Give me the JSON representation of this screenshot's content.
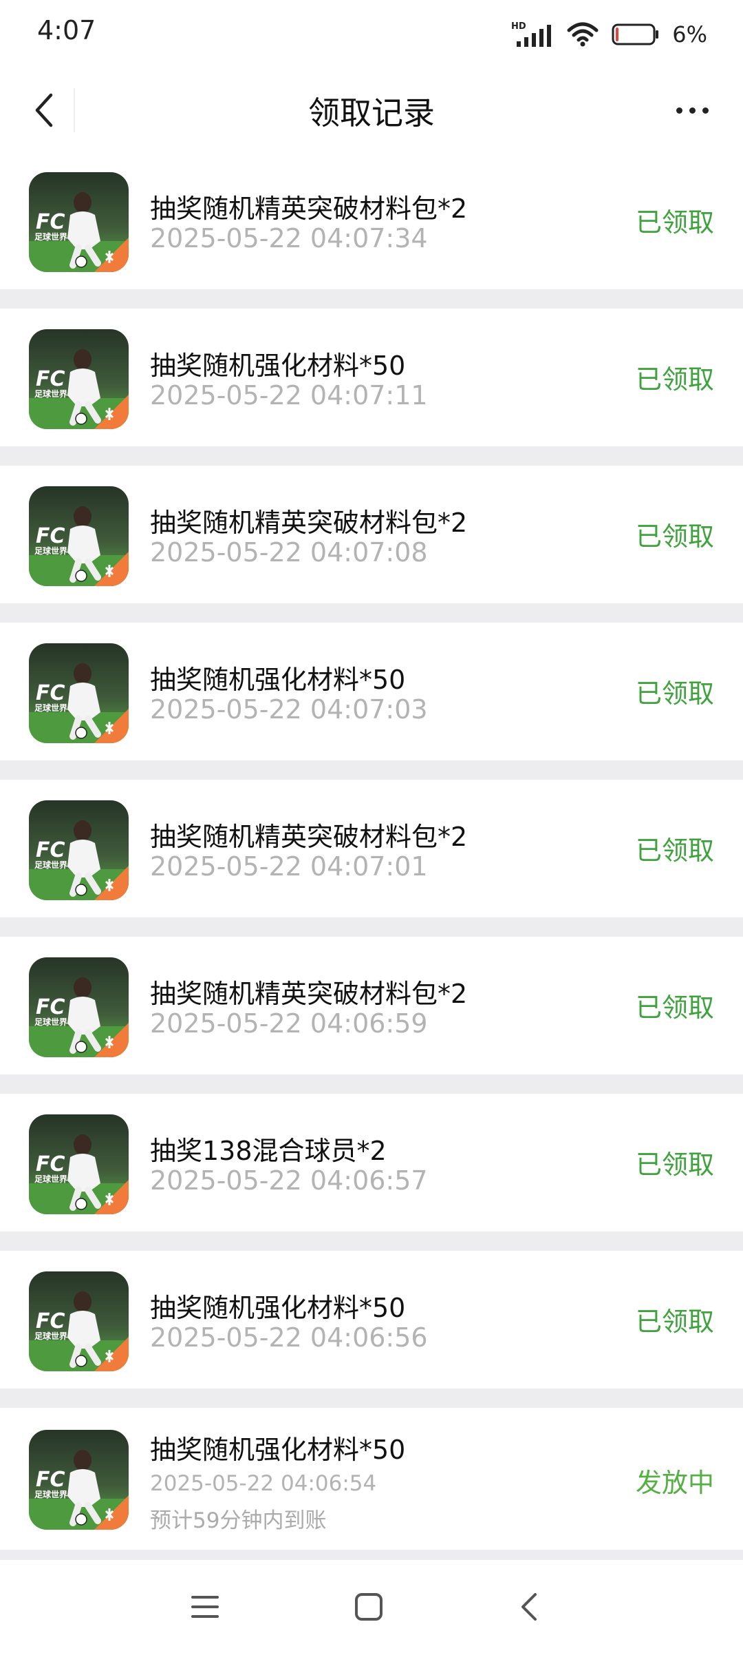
{
  "status_bar": {
    "time": "4:07",
    "network_label": "HD",
    "battery_percent": "6%",
    "battery_level": 0.06
  },
  "header": {
    "title": "领取记录"
  },
  "records": [
    {
      "title": "抽奖随机精英突破材料包*2",
      "time": "2025-05-22 04:07:34",
      "status": "已领取"
    },
    {
      "title": "抽奖随机强化材料*50",
      "time": "2025-05-22 04:07:11",
      "status": "已领取"
    },
    {
      "title": "抽奖随机精英突破材料包*2",
      "time": "2025-05-22 04:07:08",
      "status": "已领取"
    },
    {
      "title": "抽奖随机强化材料*50",
      "time": "2025-05-22 04:07:03",
      "status": "已领取"
    },
    {
      "title": "抽奖随机精英突破材料包*2",
      "time": "2025-05-22 04:07:01",
      "status": "已领取"
    },
    {
      "title": "抽奖随机精英突破材料包*2",
      "time": "2025-05-22 04:06:59",
      "status": "已领取"
    },
    {
      "title": "抽奖138混合球员*2",
      "time": "2025-05-22 04:06:57",
      "status": "已领取"
    },
    {
      "title": "抽奖随机强化材料*50",
      "time": "2025-05-22 04:06:56",
      "status": "已领取"
    },
    {
      "title": "抽奖随机强化材料*50",
      "time": "2025-05-22 04:06:54",
      "status": "发放中",
      "note": "预计59分钟内到账"
    }
  ],
  "game_icon": {
    "logo_text": "FC",
    "logo_subtext": "足球世界"
  },
  "colors": {
    "claimed_green": "#3fa33d",
    "pending_green": "#54b042",
    "timestamp_gray": "#b3b3b3",
    "list_background": "#ededf0"
  }
}
